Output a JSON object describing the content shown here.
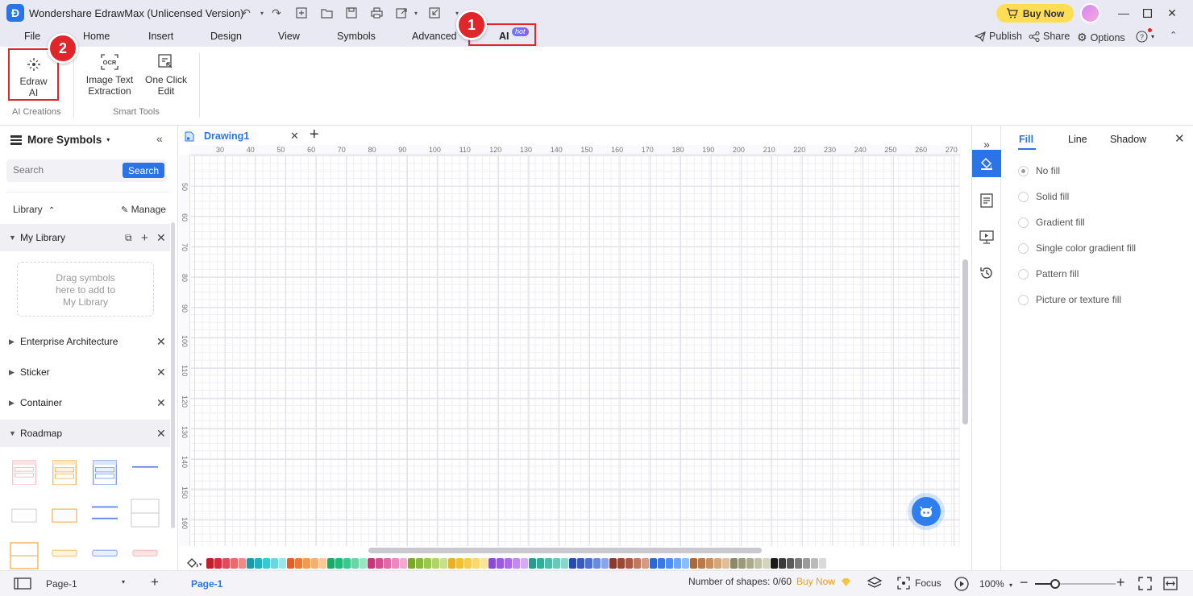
{
  "window": {
    "title": "Wondershare EdrawMax (Unlicensed Version)",
    "buy_now": "Buy Now"
  },
  "menu": {
    "items": [
      "File",
      "Home",
      "Insert",
      "Design",
      "View",
      "Symbols",
      "Advanced"
    ],
    "ai_label": "AI",
    "ai_badge": "hot",
    "publish": "Publish",
    "share": "Share",
    "options": "Options"
  },
  "callouts": [
    "1",
    "2"
  ],
  "ribbon": {
    "edraw_ai": [
      "Edraw",
      "AI"
    ],
    "ocr_icon_text": "OCR",
    "image_text_extraction": [
      "Image Text",
      "Extraction"
    ],
    "one_click_edit": [
      "One Click",
      "Edit"
    ],
    "group_ai_creations": "AI Creations",
    "group_smart_tools": "Smart Tools"
  },
  "left_panel": {
    "title": "More Symbols",
    "search_placeholder": "Search",
    "search_button": "Search",
    "library_label": "Library",
    "manage": "Manage",
    "my_library": "My Library",
    "drop_hint": [
      "Drag symbols",
      "here to add to",
      "My Library"
    ],
    "libraries": [
      "Enterprise Architecture",
      "Sticker",
      "Container",
      "Roadmap"
    ]
  },
  "canvas": {
    "doc_tab": "Drawing1",
    "ruler_top": [
      "30",
      "40",
      "50",
      "60",
      "70",
      "80",
      "90",
      "100",
      "110",
      "120",
      "130",
      "140",
      "150",
      "160",
      "170",
      "180",
      "190",
      "200",
      "210",
      "220",
      "230",
      "240",
      "250",
      "260",
      "270"
    ],
    "ruler_left": [
      "50",
      "60",
      "70",
      "80",
      "90",
      "100",
      "110",
      "120",
      "130",
      "140",
      "150",
      "160"
    ]
  },
  "palette": [
    "#c0202a",
    "#d62b3a",
    "#e04a5a",
    "#e86a6a",
    "#f08a8a",
    "#1a9aa8",
    "#22b0c0",
    "#3ac6d4",
    "#6ad6e0",
    "#9ae4ea",
    "#e0602a",
    "#ec7a36",
    "#f29a52",
    "#f4b070",
    "#f8c898",
    "#1aa86a",
    "#22b87a",
    "#3ac88e",
    "#6ad6a8",
    "#9ae4c4",
    "#c03a7a",
    "#d24e90",
    "#e06aa8",
    "#e88ac0",
    "#f0aad4",
    "#7aa82a",
    "#8ab83a",
    "#9ac84e",
    "#b0d46a",
    "#c8e08e",
    "#e8b02a",
    "#f0c036",
    "#f4cc52",
    "#f8d870",
    "#fae498",
    "#8a4ad2",
    "#9a5ae0",
    "#aa6aea",
    "#c08af0",
    "#d4aaf4",
    "#2a9a8a",
    "#34aa98",
    "#4ebaa8",
    "#6ac8b8",
    "#8ad6c8",
    "#2a4ab0",
    "#3a5ac0",
    "#4e6ed0",
    "#6a8ae0",
    "#8aa6ea",
    "#8a3a2a",
    "#9a4a34",
    "#aa5a44",
    "#c07a62",
    "#d49a84",
    "#2a6ad2",
    "#3a7ae0",
    "#4e8ef0",
    "#6aa6f4",
    "#8abef8",
    "#a86a3a",
    "#b87a4a",
    "#c88e5e",
    "#d4a67a",
    "#e0be9a",
    "#8a8a6a",
    "#9a9a7a",
    "#aaaa8e",
    "#c0c0a6",
    "#d4d4c0",
    "#1a1a1a",
    "#3a3a3a",
    "#5a5a5a",
    "#7a7a7a",
    "#9a9a9a",
    "#bababa",
    "#dadada"
  ],
  "right_panel": {
    "tabs": [
      "Fill",
      "Line",
      "Shadow"
    ],
    "fill_options": [
      "No fill",
      "Solid fill",
      "Gradient fill",
      "Single color gradient fill",
      "Pattern fill",
      "Picture or texture fill"
    ]
  },
  "status": {
    "page_select": "Page-1",
    "page_tab": "Page-1",
    "shapes": "Number of shapes: 0/60",
    "buy_now": "Buy Now",
    "focus": "Focus",
    "zoom": "100%"
  }
}
